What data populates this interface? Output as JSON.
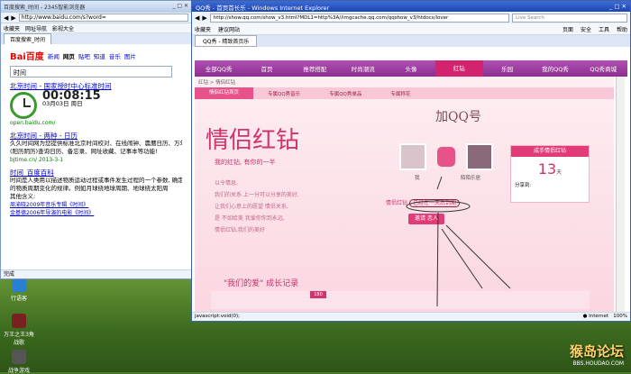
{
  "left_browser": {
    "window_title": "百度搜索_时间 - 2345智能浏览器",
    "url": "http://www.baidu.com/s?word=",
    "fav": [
      "收藏夹",
      "网址导航",
      "影视大全"
    ],
    "tab": "百度搜索_时间",
    "logo": "Bai百度",
    "nav": [
      "新闻",
      "网页",
      "贴吧",
      "知道",
      "音乐",
      "图片"
    ],
    "query": "时间",
    "result1_title": "北京时间 - 国家授时中心标准时间",
    "clock_time": "00:08:15",
    "clock_date": "03月03日 周日",
    "result1_url": "open.baidu.com/",
    "result2_title": "北京时间 - 两种 - 日历",
    "result2_text": "久久时间网为您提供标准北京时间校对、在线闹钟、農曆日历、万年历",
    "result2_text2": "(阳历阴历)查询日历、备忘录、网址收藏、记事本等功能!",
    "result2_url": "bjtime.cn/ 2013-3-1",
    "result3_title": "时间_百度百科",
    "result3_text": "时间是人类用以描述物质运动过程或事件发生过程的一个参数, 确定时间",
    "result3_text2": "的物质周期变化的规律。例如月球绕地球周期、地球绕太阳周",
    "result3_more": "其他含义:",
    "result3_links": [
      "周渝晓2009年音乐专辑《时间》",
      "金基德2006年导演的电影《时间》"
    ],
    "status": "完成"
  },
  "right_browser": {
    "window_title": "QQ秀 - 首页首长乐 - Windows Internet Explorer",
    "url": "http://show.qq.com/show_v3.html?MDL1=http%3A//imgcache.qq.com/qqshow_v3/htdocs/lover",
    "search_placeholder": "Live Search",
    "menu": [
      "收藏夹",
      "建议网站",
      "页面",
      "安全",
      "工具",
      "帮助"
    ],
    "tab": "QQ秀 - 精致首页乐",
    "nav": [
      "全部QQ秀",
      "首页",
      "推荐搭配",
      "时尚潮流",
      "头像",
      "红钻",
      "乐园",
      "我的QQ秀",
      "QQ秀商城"
    ],
    "breadcrumb": "红钻 > 情侣红钻",
    "subtabs": [
      "情侣红钻首页",
      "专属QQ秀音乐",
      "专属QQ秀单品",
      "专属称花"
    ],
    "headline": "情侣红钻",
    "slogan": "我的红钻, 有你的一半",
    "poem": [
      "以令情息,",
      "我们的关系 上一分可以分享的美好,",
      "让我们心意上的愿望 情侣关系,",
      "是 不如给美 我爱你你到永远,",
      "情侣红钻,我们的美好"
    ],
    "handwriting": "加QQ号",
    "name_left": "我",
    "name_right": "陌陌乐居",
    "days_label": "情侣红钻",
    "days_text": "已经在一天后到期",
    "invite_button": "邀请 恋人",
    "renew_header": "成手情侣红钻",
    "days_count": "13",
    "days_unit": "天",
    "share_label": "分享到:",
    "growth_title": "\"我们的爱\" 成长记录",
    "growth_badge": "180",
    "status_left": "javascript:void(0);",
    "status_zone": "Internet",
    "zoom": "100%"
  },
  "desktop": {
    "icons": [
      "行语客",
      "万王之王3角 战歌",
      "战争游戏"
    ]
  },
  "watermark": {
    "line1": "猴岛论坛",
    "line2": "BBS.HOUDAO.COM"
  }
}
